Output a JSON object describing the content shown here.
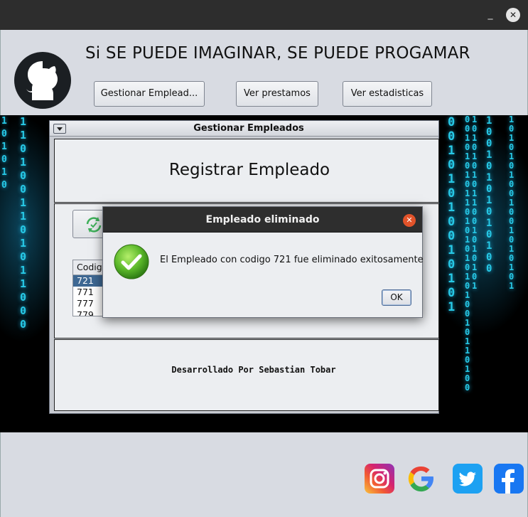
{
  "window": {
    "minimize_glyph": "_",
    "close_glyph": "✕"
  },
  "header": {
    "slogan": "Si SE PUEDE IMAGINAR, SE PUEDE PROGAMAR",
    "buttons": {
      "employees": "Gestionar Emplead...",
      "loans": "Ver prestamos",
      "stats": "Ver estadisticas"
    }
  },
  "internal_frame": {
    "title": "Gestionar Empleados",
    "heading": "Registrar Empleado",
    "table": {
      "header": "Codigo",
      "rows": [
        "721",
        "771",
        "777",
        "779"
      ],
      "selected_index": 0
    },
    "credit": "Desarrollado Por Sebastian Tobar"
  },
  "dialog": {
    "title": "Empleado eliminado",
    "message": "El Empleado con codigo 721 fue eliminado exitosamente",
    "ok_label": "OK",
    "close_glyph": "✕"
  },
  "social": {
    "icons": [
      "instagram-icon",
      "google-icon",
      "twitter-icon",
      "facebook-icon"
    ]
  },
  "colors": {
    "matrix_text": "#27c9e6",
    "dialog_title_bar": "#2e2e2e",
    "selected_row": "#3e6893",
    "panel_bg": "#d8dbe2"
  }
}
